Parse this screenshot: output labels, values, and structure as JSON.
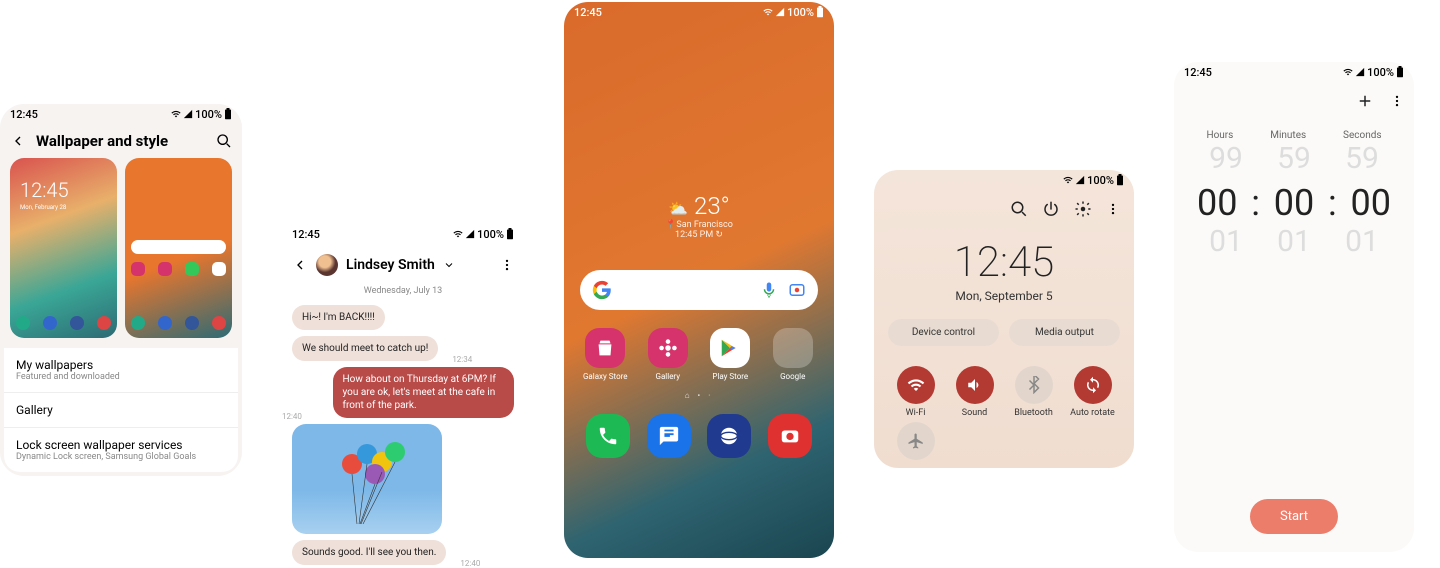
{
  "status": {
    "time": "12:45",
    "battery": "100%"
  },
  "p1": {
    "title": "Wallpaper and style",
    "thumb_clock": "12:45",
    "thumb_date": "Mon, February 28",
    "list": [
      {
        "title": "My wallpapers",
        "sub": "Featured and downloaded"
      },
      {
        "title": "Gallery",
        "sub": ""
      },
      {
        "title": "Lock screen wallpaper services",
        "sub": "Dynamic Lock screen, Samsung Global Goals"
      }
    ]
  },
  "p2": {
    "contact": "Lindsey Smith",
    "date": "Wednesday, July 13",
    "msgs": {
      "m0": "Hi~! I'm BACK!!!!",
      "m1": "We should meet to catch up!",
      "t1": "12:34",
      "m2": "How about on Thursday at 6PM? If you are ok, let's meet at the cafe in front of the park.",
      "t2": "12:40",
      "m3": "Sounds good. I'll see you then.",
      "t3": "12:40"
    }
  },
  "p3": {
    "weather": {
      "temp": "23°",
      "loc": "San Francisco",
      "time": "12:45 PM"
    },
    "apps": [
      "Galaxy Store",
      "Gallery",
      "Play Store",
      "Google"
    ]
  },
  "p4": {
    "clock": "12:45",
    "date": "Mon, September 5",
    "pills": [
      "Device control",
      "Media output"
    ],
    "tiles": [
      "Wi-Fi",
      "Sound",
      "Bluetooth",
      "Auto rotate"
    ]
  },
  "p5": {
    "labels": [
      "Hours",
      "Minutes",
      "Seconds"
    ],
    "ghost_top": [
      "99",
      "59",
      "59"
    ],
    "value": [
      "00",
      "00",
      "00"
    ],
    "ghost_bot": [
      "01",
      "01",
      "01"
    ],
    "start": "Start"
  }
}
